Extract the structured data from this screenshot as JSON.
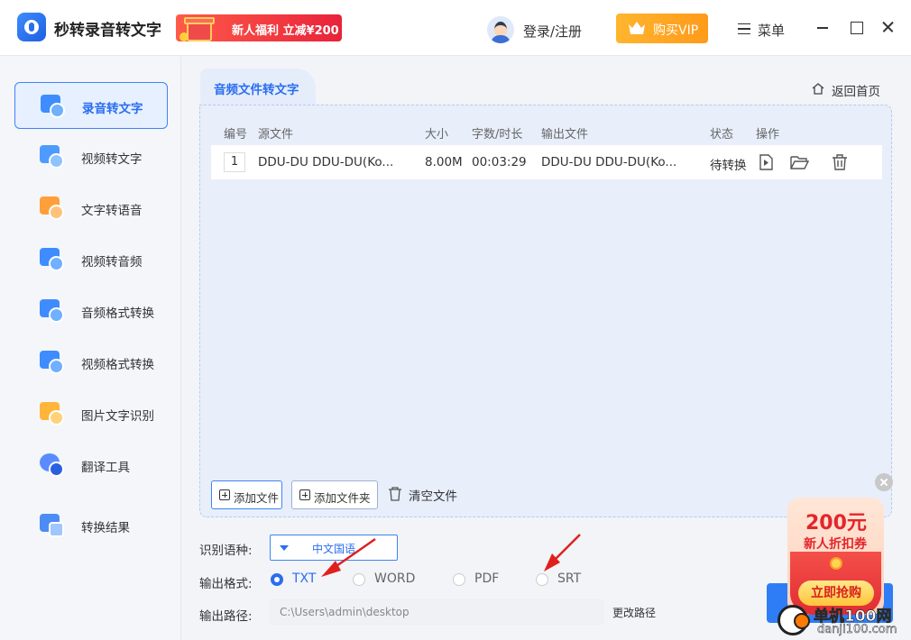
{
  "app": {
    "title": "秒转录音转文字",
    "promo": "新人福利 立减¥200",
    "login": "登录/注册",
    "vip": "购买VIP",
    "menu": "菜单"
  },
  "sidebar": {
    "items": [
      {
        "label": "录音转文字",
        "icon": "audio-to-text-icon",
        "active": true
      },
      {
        "label": "视频转文字",
        "icon": "video-to-text-icon",
        "active": false
      },
      {
        "label": "文字转语音",
        "icon": "text-to-speech-icon",
        "active": false
      },
      {
        "label": "视频转音频",
        "icon": "video-to-audio-icon",
        "active": false
      },
      {
        "label": "音频格式转换",
        "icon": "audio-format-icon",
        "active": false
      },
      {
        "label": "视频格式转换",
        "icon": "video-format-icon",
        "active": false
      },
      {
        "label": "图片文字识别",
        "icon": "image-ocr-icon",
        "active": false
      },
      {
        "label": "翻译工具",
        "icon": "translate-icon",
        "active": false
      },
      {
        "label": "转换结果",
        "icon": "result-icon",
        "active": false
      }
    ]
  },
  "main": {
    "tab": "音频文件转文字",
    "home": "返回首页",
    "table": {
      "headers": [
        "编号",
        "源文件",
        "大小",
        "字数/时长",
        "输出文件",
        "状态",
        "操作"
      ],
      "rows": [
        {
          "num": "1",
          "source": "DDU-DU DDU-DU(Ko...",
          "size": "8.00M",
          "duration": "00:03:29",
          "output": "DDU-DU DDU-DU(Ko...",
          "status": "待转换"
        }
      ]
    },
    "buttons": {
      "add_file": "添加文件",
      "add_folder": "添加文件夹",
      "clear": "清空文件"
    }
  },
  "settings": {
    "language_label": "识别语种:",
    "language_value": "中文国语",
    "format_label": "输出格式:",
    "formats": [
      "TXT",
      "WORD",
      "PDF",
      "SRT"
    ],
    "selected_format": "TXT",
    "path_label": "输出路径:",
    "path_value": "C:\\Users\\admin\\desktop",
    "change_path": "更改路径"
  },
  "coupon": {
    "amount": "200元",
    "subtitle": "新人折扣券",
    "button": "立即抢购"
  },
  "watermark": {
    "line1": "单机100网",
    "line2": "danji100.com"
  },
  "colors": {
    "accent": "#2a6df0",
    "vip": "#ffa623",
    "promo": "#e8233a",
    "arrow": "#e0201c"
  }
}
